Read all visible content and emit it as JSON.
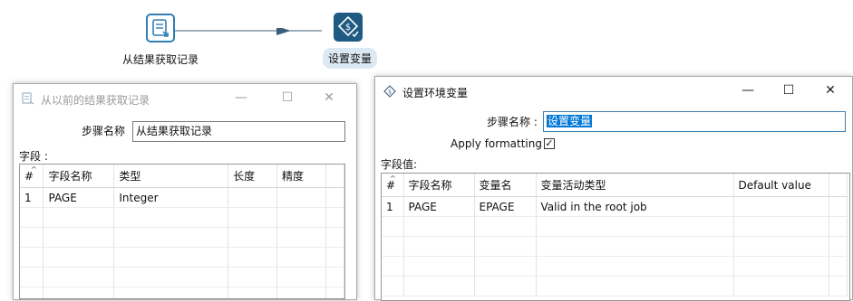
{
  "canvas": {
    "nodes": [
      {
        "label": "从结果获取记录"
      },
      {
        "label": "设置变量"
      }
    ]
  },
  "dialog_rows_from_result": {
    "title": "从以前的结果获取记录",
    "step_name_label": "步骤名称",
    "step_name_value": "从结果获取记录",
    "fields_label": "字段 :",
    "columns": [
      "#",
      "字段名称",
      "类型",
      "长度",
      "精度"
    ],
    "rows": [
      [
        "1",
        "PAGE",
        "Integer",
        "",
        ""
      ]
    ]
  },
  "dialog_set_variables": {
    "title": "设置环境变量",
    "step_name_label": "步骤名称 :",
    "step_name_value": "设置变量",
    "apply_formatting_label": "Apply formatting",
    "apply_formatting_checked": true,
    "field_values_label": "字段值:",
    "columns": [
      "#",
      "字段名称",
      "变量名",
      "变量活动类型",
      "Default value"
    ],
    "rows": [
      [
        "1",
        "PAGE",
        "EPAGE",
        "Valid in the root job",
        ""
      ]
    ]
  },
  "window_buttons": {
    "minimize": "—",
    "maximize": "☐",
    "close": "✕"
  },
  "colors": {
    "accent": "#2f7fb2",
    "node_dark": "#1e5a82",
    "selection": "#0078d7"
  }
}
